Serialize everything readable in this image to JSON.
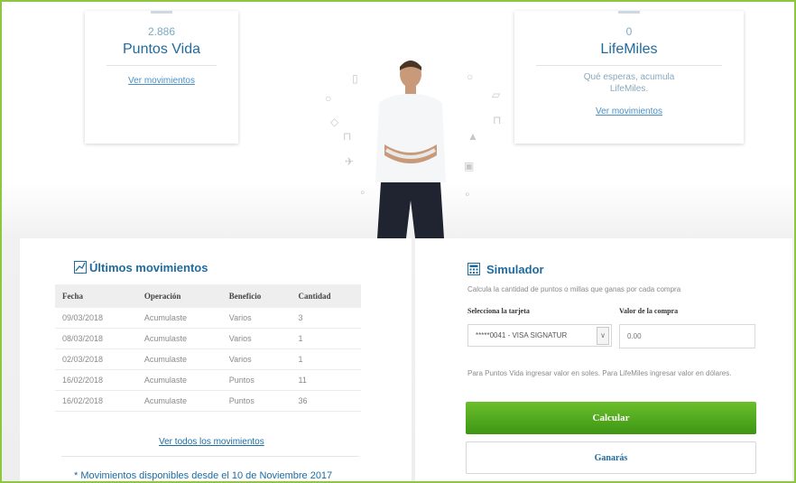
{
  "hero": {
    "puntos": {
      "value": "2.886",
      "title": "Puntos Vida",
      "link": "Ver movimientos"
    },
    "lifemiles": {
      "value": "0",
      "title": "LifeMiles",
      "note": "Qué esperas, acumula LifeMiles.",
      "link": "Ver movimientos"
    }
  },
  "movimientos": {
    "title": "Últimos movimientos",
    "columns": [
      "Fecha",
      "Operación",
      "Beneficio",
      "Cantidad"
    ],
    "rows": [
      [
        "09/03/2018",
        "Acumulaste",
        "Varios",
        "3"
      ],
      [
        "08/03/2018",
        "Acumulaste",
        "Varios",
        "1"
      ],
      [
        "02/03/2018",
        "Acumulaste",
        "Varios",
        "1"
      ],
      [
        "16/02/2018",
        "Acumulaste",
        "Puntos",
        "11"
      ],
      [
        "16/02/2018",
        "Acumulaste",
        "Puntos",
        "36"
      ]
    ],
    "all_link": "Ver todos los movimientos",
    "footnote": "* Movimientos disponibles desde el 10 de Noviembre 2017"
  },
  "simulador": {
    "title": "Simulador",
    "description": "Calcula la cantidad de puntos o millas que ganas por cada compra",
    "card_label": "Selecciona la tarjeta",
    "card_value": "*****0041 - VISA SIGNATUR",
    "amount_label": "Valor de la compra",
    "amount_placeholder": "0.00",
    "hint": "Para Puntos Vida ingresar valor en soles. Para LifeMiles ingresar valor en dólares.",
    "calc_button": "Calcular",
    "result_button": "Ganarás"
  },
  "colors": {
    "accent": "#1f6b9e",
    "button": "#4fa51d",
    "frame": "#8dc63f"
  },
  "icons": [
    "chart-icon",
    "calculator-icon",
    "chevron-down-icon"
  ]
}
